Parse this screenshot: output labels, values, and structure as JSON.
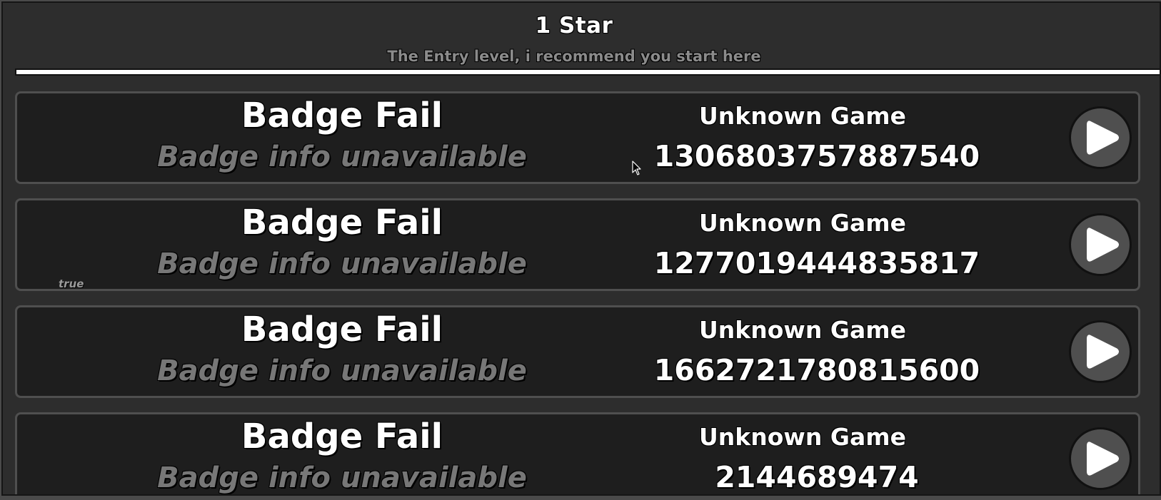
{
  "header": {
    "title": "1 Star",
    "subtitle": "The Entry level, i recommend you start here"
  },
  "rows": [
    {
      "badge_name": "Badge Fail",
      "badge_info": "Badge info unavailable",
      "game_name": "Unknown Game",
      "badge_id": "1306803757887540",
      "status": ""
    },
    {
      "badge_name": "Badge Fail",
      "badge_info": "Badge info unavailable",
      "game_name": "Unknown Game",
      "badge_id": "1277019444835817",
      "status": "true"
    },
    {
      "badge_name": "Badge Fail",
      "badge_info": "Badge info unavailable",
      "game_name": "Unknown Game",
      "badge_id": "1662721780815600",
      "status": ""
    },
    {
      "badge_name": "Badge Fail",
      "badge_info": "Badge info unavailable",
      "game_name": "Unknown Game",
      "badge_id": "2144689474",
      "status": ""
    }
  ],
  "icons": {
    "play": "play-icon",
    "cursor": "mouse-cursor-icon"
  },
  "colors": {
    "panel_bg": "#2d2d2d",
    "row_bg": "#1e1e1e",
    "row_border": "#4f4f4f",
    "muted_text": "#777777",
    "play_button_bg": "#4f4f4f"
  }
}
